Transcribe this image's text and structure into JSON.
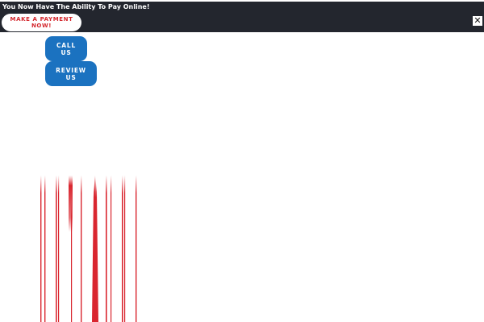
{
  "banner": {
    "message": "You Now Have The Ability To Pay Online!",
    "payment_button_label": "MAKE A PAYMENT NOW!",
    "close_label": "✕"
  },
  "buttons": {
    "call_label": "CALL US",
    "review_label": "REVIEW US"
  },
  "colors": {
    "banner_background": "#23262e",
    "payment_text": "#d4262c",
    "action_button": "#1b72c0",
    "decorative_lines": "#d9262f"
  }
}
